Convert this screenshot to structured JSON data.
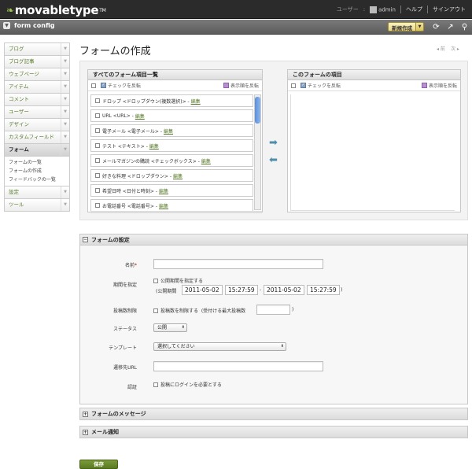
{
  "header": {
    "logo": "movabletype",
    "logo_tm": "TM",
    "user_label": "ユーザー",
    "username": "admin",
    "help": "ヘルプ",
    "signout": "サインアウト"
  },
  "subbar": {
    "blog_name": "form config",
    "new_button": "新規作成",
    "icons": [
      "refresh-icon",
      "external-link-icon",
      "search-icon"
    ]
  },
  "sidebar": {
    "items": [
      {
        "label": "ブログ"
      },
      {
        "label": "ブログ記事"
      },
      {
        "label": "ウェブページ"
      },
      {
        "label": "アイテム"
      },
      {
        "label": "コメント"
      },
      {
        "label": "ユーザー"
      },
      {
        "label": "デザイン"
      },
      {
        "label": "カスタムフィールド"
      },
      {
        "label": "フォーム",
        "active": true
      },
      {
        "label": "設定"
      },
      {
        "label": "ツール"
      }
    ],
    "subitems": [
      "フォームの一覧",
      "フォームの作成",
      "フィードバックの一覧"
    ]
  },
  "page": {
    "title": "フォームの作成",
    "prev": "前",
    "next": "次"
  },
  "builder": {
    "all_title": "すべてのフォーム項目一覧",
    "this_title": "このフォームの項目",
    "invert_check": "チェックを反転",
    "invert_order": "表示順を反転",
    "edit": "編集",
    "items": [
      "ドロップ <ドロップダウン(複数選択)> -",
      "URL <URL> -",
      "電子メール <電子メール> -",
      "テスト <テキスト> -",
      "メールマガジンの購読 <チェックボックス> -",
      "好きな料理 <ドロップダウン> -",
      "希望日時 <日付と時刻> -",
      "お電話番号 <電話番号> -"
    ]
  },
  "settings": {
    "title": "フォームの設定",
    "name_label": "名前",
    "required_mark": "*",
    "period_label": "期間を指定",
    "period_check": "公開期間を指定する",
    "period_prefix": "(公開期間",
    "date_start": "2011-05-02",
    "time_start": "15:27:59",
    "date_sep": "-",
    "date_end": "2011-05-02",
    "time_end": "15:27:59",
    "period_suffix": ")",
    "limit_label": "投稿数制限",
    "limit_check": "投稿数を制限する",
    "limit_prefix": "(受付ける最大投稿数",
    "limit_suffix": ")",
    "status_label": "ステータス",
    "status_value": "公開",
    "template_label": "テンプレート",
    "template_value": "選択してください",
    "redirect_label": "遷移先URL",
    "auth_label": "認証",
    "auth_check": "投稿にログインを必要とする"
  },
  "sections": {
    "messages": "フォームのメッセージ",
    "mail": "メール通知"
  },
  "actions": {
    "save": "保存"
  }
}
